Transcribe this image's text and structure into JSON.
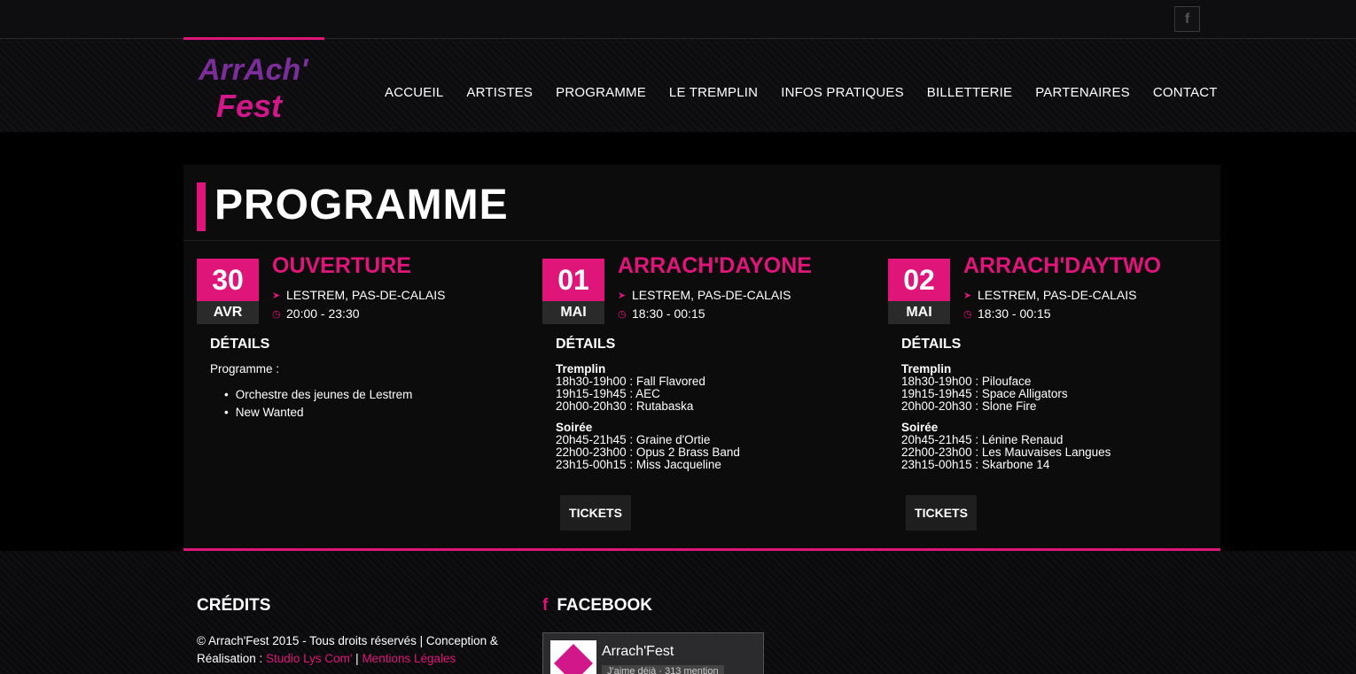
{
  "social": {
    "facebook_label": "f"
  },
  "brand": {
    "logo_line1": "ArrAch'",
    "logo_line2": "Fest",
    "logo_color1": "#7b2d9a",
    "logo_color2": "#d2178a"
  },
  "nav": [
    "ACCUEIL",
    "ARTISTES",
    "PROGRAMME",
    "LE TREMPLIN",
    "INFOS PRATIQUES",
    "BILLETTERIE",
    "PARTENAIRES",
    "CONTACT"
  ],
  "page": {
    "title": "PROGRAMME"
  },
  "colors": {
    "accent": "#e0157a"
  },
  "events": [
    {
      "day": "30",
      "month": "AVR",
      "title": "OUVERTURE",
      "location": "LESTREM, PAS-DE-CALAIS",
      "time": "20:00 - 23:30",
      "details_heading": "DÉTAILS",
      "program_label": "Programme :",
      "bullets": [
        "Orchestre des jeunes de Lestrem",
        "New Wanted"
      ]
    },
    {
      "day": "01",
      "month": "MAI",
      "title": "ARRACH'DAYONE",
      "location": "LESTREM, PAS-DE-CALAIS",
      "time": "18:30 - 00:15",
      "details_heading": "DÉTAILS",
      "sections": [
        {
          "name": "Tremplin",
          "lines": [
            "18h30-19h00 : Fall Flavored",
            "19h15-19h45 : AEC",
            "20h00-20h30 : Rutabaska"
          ]
        },
        {
          "name": "Soirée",
          "lines": [
            "20h45-21h45 : Graine d'Ortie",
            "22h00-23h00 : Opus 2 Brass Band",
            "23h15-00h15 : Miss Jacqueline"
          ]
        }
      ],
      "tickets_label": "TICKETS"
    },
    {
      "day": "02",
      "month": "MAI",
      "title": "ARRACH'DAYTWO",
      "location": "LESTREM, PAS-DE-CALAIS",
      "time": "18:30 - 00:15",
      "details_heading": "DÉTAILS",
      "sections": [
        {
          "name": "Tremplin",
          "lines": [
            "18h30-19h00 : Pilouface",
            "19h15-19h45 : Space Alligators",
            "20h00-20h30 : Slone Fire"
          ]
        },
        {
          "name": "Soirée",
          "lines": [
            "20h45-21h45 : Lénine Renaud",
            "22h00-23h00 : Les Mauvaises Langues",
            "23h15-00h15 : Skarbone 14"
          ]
        }
      ],
      "tickets_label": "TICKETS"
    }
  ],
  "footer": {
    "credits_heading": "CRÉDITS",
    "credits_text": "© Arrach'Fest 2015 - Tous droits réservés | Conception & Réalisation : ",
    "link_studio": "Studio Lys Com'",
    "separator": " | ",
    "link_legal": "Mentions Légales",
    "facebook_heading": "FACEBOOK",
    "fb_page_name": "Arrach'Fest",
    "fb_like": "J'aime déjà · 313 mention"
  }
}
